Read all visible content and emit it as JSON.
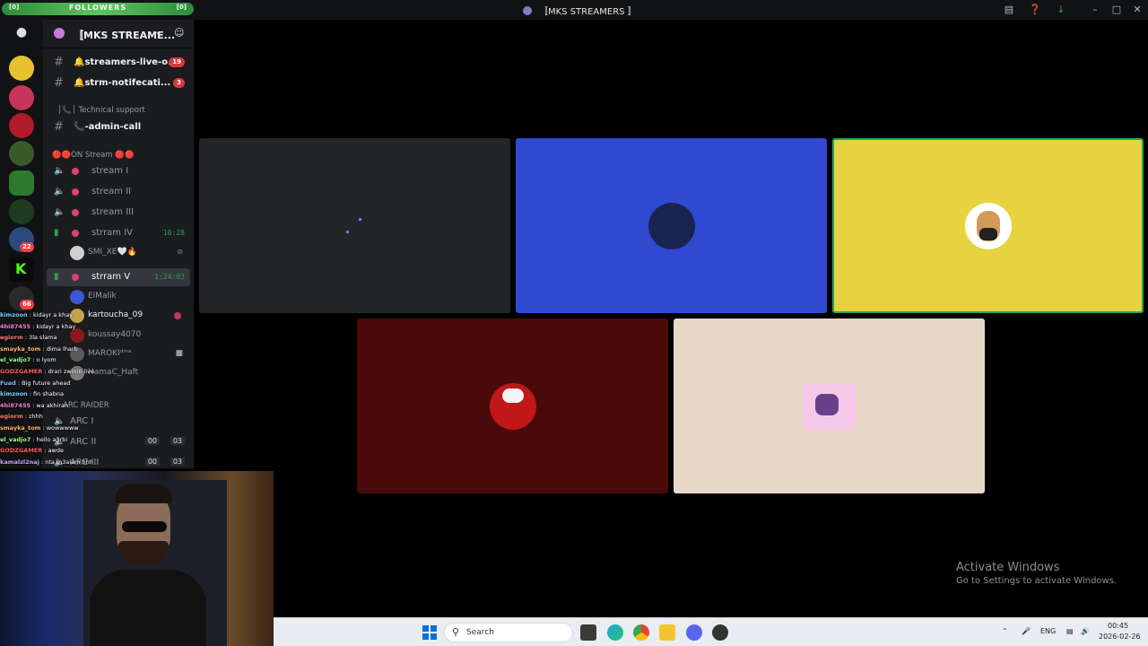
{
  "titlebar": {
    "followers_label": "FOLLOWERS",
    "followers_left": "[0]",
    "followers_right": "[0]",
    "window_title": "〚MKS STREAMERS 〛"
  },
  "server": {
    "name": "〚MKS STREAME...",
    "server_badges": [
      "22",
      "66"
    ]
  },
  "channels": {
    "text": [
      {
        "name": "🔔streamers-live-o...",
        "count": "19"
      },
      {
        "name": "🔔strm-notifecati...",
        "count": "3"
      }
    ],
    "category_support": "│📞│ Technical support",
    "admin_call": "📞-admin-call",
    "category_stream": "🔴🔴ON Stream 🔴🔴",
    "voice": [
      {
        "name": "stream I",
        "timer": ""
      },
      {
        "name": "stream II",
        "timer": ""
      },
      {
        "name": "stream III",
        "timer": ""
      },
      {
        "name": "strram IV",
        "timer": "10:28"
      },
      {
        "name": "strram V",
        "timer": "1:24:03"
      }
    ],
    "voice_iv_user": "SMI_XE🤍🔥",
    "voice_v_users": [
      "ElMalik",
      "kartoucha_09",
      "koussay4070",
      "MAROKIᵈᵐᵃ",
      "HamaC_Haft"
    ],
    "category_arc": "ARC RAIDER",
    "arc": [
      {
        "name": "ARC I",
        "c1": "",
        "c2": ""
      },
      {
        "name": "ARC II",
        "c1": "00",
        "c2": "03"
      },
      {
        "name": "ARC III",
        "c1": "00",
        "c2": "03"
      }
    ]
  },
  "chat": [
    {
      "user": "kimzoon",
      "msg": ": kidayr a khay",
      "color": "#6fd3ff"
    },
    {
      "user": "4hi87455",
      "msg": ": kidayr a khay",
      "color": "#ff7ad9"
    },
    {
      "user": "egiorm",
      "msg": ": 3la slama",
      "color": "#ff7a7a"
    },
    {
      "user": "smayka_tom",
      "msg": ": dima lharb",
      "color": "#ffb36b"
    },
    {
      "user": "el_vadjo7",
      "msg": ": o lyom",
      "color": "#9cff8a"
    },
    {
      "user": "GODZGAMER",
      "msg": ": drari zwinin live",
      "color": "#ff5a5a"
    },
    {
      "user": "Fuad",
      "msg": ": Big future ahead",
      "color": "#8ab4ff"
    },
    {
      "user": "kimzoon",
      "msg": ": fin shabna",
      "color": "#6fd3ff"
    },
    {
      "user": "4hi87455",
      "msg": ": wa akhiran",
      "color": "#ff7ad9"
    },
    {
      "user": "egiorm",
      "msg": ": zhhh",
      "color": "#ff7a7a"
    },
    {
      "user": "smayka_tom",
      "msg": ": wowwwww",
      "color": "#ffb36b"
    },
    {
      "user": "el_vadjo7",
      "msg": ": hello a3rbi",
      "color": "#9cff8a"
    },
    {
      "user": "GODZGAMER",
      "msg": ": awde",
      "color": "#ff5a5a"
    },
    {
      "user": "kamalzl2naj",
      "msg": ": nta m3alam hhh",
      "color": "#c9a7ff"
    }
  ],
  "stage": {
    "tiles": [
      {
        "bg": "#232428"
      },
      {
        "bg": "#2f49d1"
      },
      {
        "bg": "#e6d33f"
      },
      {
        "bg": "#4a0a0a"
      },
      {
        "bg": "#e8d8c8"
      }
    ]
  },
  "watermark": {
    "line1": "Activate Windows",
    "line2": "Go to Settings to activate Windows."
  },
  "taskbar": {
    "search_label": "Search",
    "lang": "ENG",
    "time": "00:45",
    "date": "2026-02-26"
  }
}
